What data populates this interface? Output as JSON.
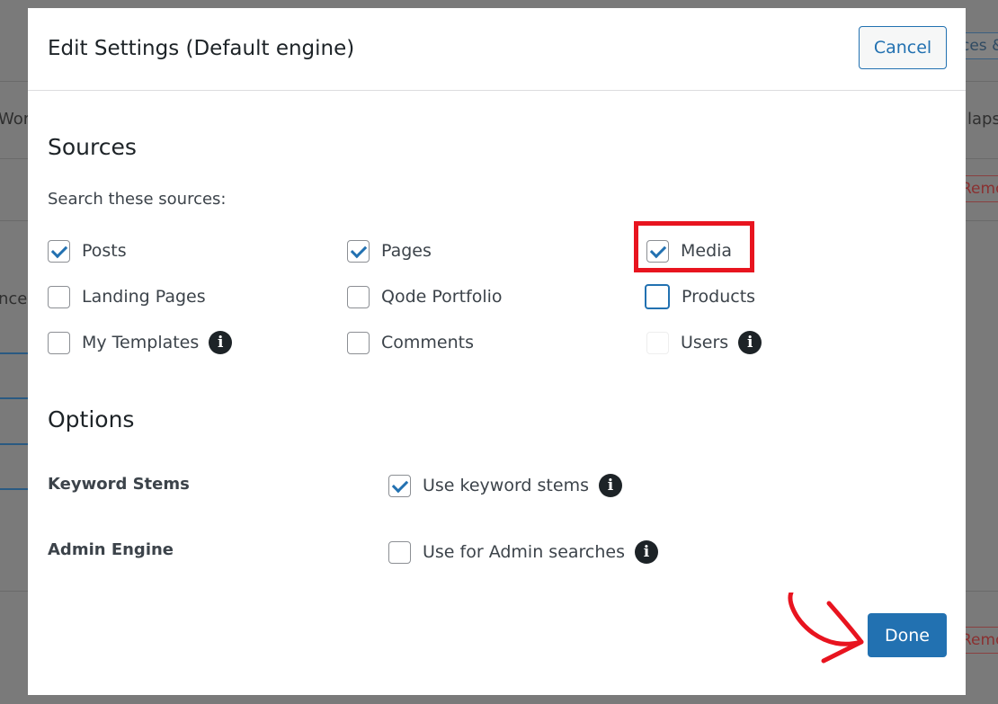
{
  "background": {
    "left_texts": [
      "Wor",
      "nce"
    ],
    "right_texts": [
      "ces &",
      "laps"
    ],
    "remove_labels": [
      "Remo",
      "Remo"
    ]
  },
  "modal": {
    "title": "Edit Settings (Default engine)",
    "cancel_label": "Cancel",
    "done_label": "Done"
  },
  "sources": {
    "heading": "Sources",
    "subtext": "Search these sources:",
    "items": [
      {
        "label": "Posts",
        "checked": true
      },
      {
        "label": "Pages",
        "checked": true
      },
      {
        "label": "Media",
        "checked": true
      },
      {
        "label": "Landing Pages",
        "checked": false
      },
      {
        "label": "Qode Portfolio",
        "checked": false
      },
      {
        "label": "Products",
        "checked": false
      },
      {
        "label": "My Templates",
        "checked": false
      },
      {
        "label": "Comments",
        "checked": false
      },
      {
        "label": "Users",
        "checked": false
      }
    ]
  },
  "options": {
    "heading": "Options",
    "keyword_stems": {
      "label": "Keyword Stems",
      "checkbox_label": "Use keyword stems",
      "checked": true
    },
    "admin_engine": {
      "label": "Admin Engine",
      "checkbox_label": "Use for Admin searches",
      "checked": false
    }
  },
  "icons": {
    "info": "info-icon",
    "arrow": "red-curved-arrow"
  },
  "colors": {
    "accent": "#2271b1",
    "highlight": "#e8141f",
    "overlay": "#7a7a7a"
  }
}
